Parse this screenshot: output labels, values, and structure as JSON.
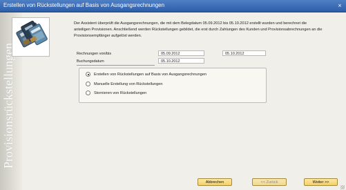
{
  "window": {
    "title": "Erstellen von Rückstellungen auf Basis von Ausgangsrechnungen",
    "close_icon": "×"
  },
  "sidebar": {
    "vertical_text": "Provisionsrückstellungen"
  },
  "description": "Der Assistent überprüft die Ausgangsrechnungen, die mit dem Belegdatum 05.09.2012 bis 05.10.2012 erstellt wurden und berechnet die anteiligen Provisionen. Anschließend werden Rückstellungen gebildet, die erst durch Zahlungen des Kunden und Provisionsabrechnungen an die Provisionsempfänger aufgelöst werden.",
  "form": {
    "invoice_label": "Rechnungen von/bis",
    "invoice_from": "05.09.2012",
    "invoice_to": "05.10.2012",
    "posting_date_label": "Buchungsdatum",
    "posting_date": "05.10.2012"
  },
  "options": [
    {
      "label": "Erstellen von Rückstellungen auf Basis von Ausgangsrechnungen",
      "selected": true
    },
    {
      "label": "Manuelle Erstellung von Rückstellungen",
      "selected": false
    },
    {
      "label": "Stornieren von Rückstellungen",
      "selected": false
    }
  ],
  "buttons": {
    "cancel": "Abbrechen",
    "back": "<< Zurück",
    "next": "Weiter >>"
  },
  "colors": {
    "titlebar": "#3b6db7",
    "button": "#f6d57a"
  }
}
